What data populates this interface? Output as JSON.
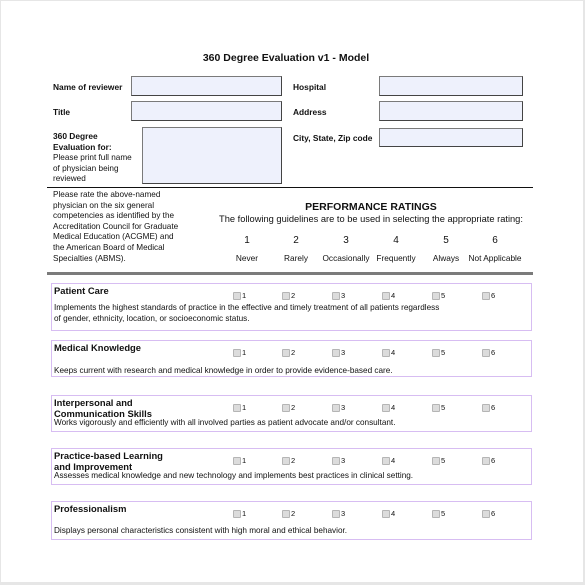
{
  "document": {
    "title": "360 Degree Evaluation v1 - Model"
  },
  "fields": {
    "reviewer_name": {
      "label": "Name of reviewer",
      "value": ""
    },
    "title": {
      "label": "Title",
      "value": ""
    },
    "evaluation_for": {
      "label_bold": [
        "360 Degree",
        "Evaluation for:"
      ],
      "label_note": [
        "Please print full name",
        "of physician being",
        "reviewed"
      ],
      "value": ""
    },
    "hospital": {
      "label": "Hospital",
      "value": ""
    },
    "address": {
      "label": "Address",
      "value": ""
    },
    "city_state_zip": {
      "label": "City, State, Zip code",
      "value": ""
    }
  },
  "instructions": [
    "Please rate the above-named",
    "physician on the six general",
    "competencies as identified by the",
    "Accreditation Council for Graduate",
    "Medical Education (ACGME) and",
    "the American Board of Medical",
    "Specialties (ABMS)."
  ],
  "performance_ratings": {
    "heading": "PERFORMANCE RATINGS",
    "subheading": "The following guidelines are to be used in selecting the appropriate rating:",
    "scale": [
      {
        "value": "1",
        "label": "Never"
      },
      {
        "value": "2",
        "label": "Rarely"
      },
      {
        "value": "3",
        "label": "Occasionally"
      },
      {
        "value": "4",
        "label": "Frequently"
      },
      {
        "value": "5",
        "label": "Always"
      },
      {
        "value": "6",
        "label": "Not Applicable"
      }
    ]
  },
  "competencies": [
    {
      "title": [
        "Patient Care"
      ],
      "description": [
        "Implements the highest standards of practice in the effective and timely treatment of all patients regardless",
        "of gender, ethnicity, location, or socioeconomic status."
      ],
      "options": [
        "1",
        "2",
        "3",
        "4",
        "5",
        "6"
      ],
      "selected": null
    },
    {
      "title": [
        "Medical Knowledge"
      ],
      "description": [
        "Keeps current with research and medical knowledge in order to provide evidence-based care."
      ],
      "options": [
        "1",
        "2",
        "3",
        "4",
        "5",
        "6"
      ],
      "selected": null
    },
    {
      "title": [
        "Interpersonal and",
        "Communication Skills"
      ],
      "description": [
        "Works vigorously and efficiently with all involved parties as patient advocate and/or consultant."
      ],
      "options": [
        "1",
        "2",
        "3",
        "4",
        "5",
        "6"
      ],
      "selected": null
    },
    {
      "title": [
        "Practice-based Learning",
        "and Improvement"
      ],
      "description": [
        "Assesses medical knowledge and new technology and implements best practices in clinical setting."
      ],
      "options": [
        "1",
        "2",
        "3",
        "4",
        "5",
        "6"
      ],
      "selected": null
    },
    {
      "title": [
        "Professionalism"
      ],
      "description": [
        "Displays personal characteristics consistent with high moral and ethical behavior."
      ],
      "options": [
        "1",
        "2",
        "3",
        "4",
        "5",
        "6"
      ],
      "selected": null
    }
  ],
  "colors": {
    "field_fill": "#eef1fc",
    "card_border": "#d7bdf2",
    "checkbox_fill": "#dcdcdc"
  }
}
